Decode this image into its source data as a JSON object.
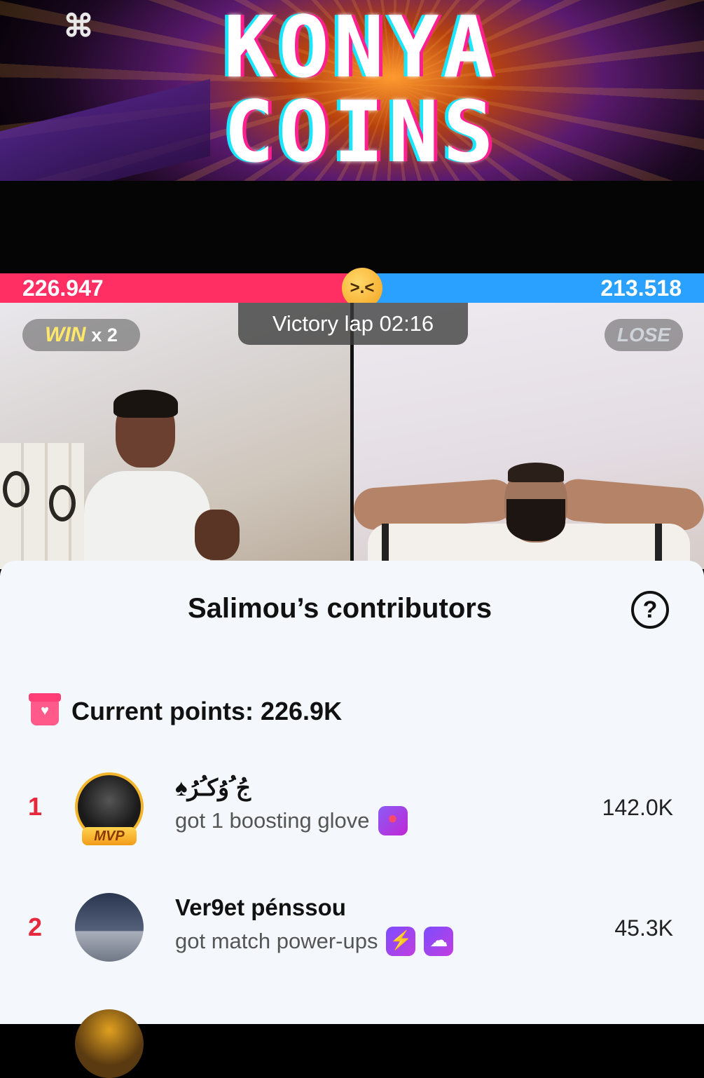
{
  "banner": {
    "title_line1": "KONYA",
    "title_line2": "COINS",
    "watermark_icon": "capcut-icon"
  },
  "battle": {
    "left_score": "226.947",
    "right_score": "213.518",
    "center_emoji": ">.<",
    "win_label": "WIN",
    "win_multiplier": "x 2",
    "lose_label": "LOSE",
    "timer_text": "Victory lap  02:16",
    "left_color": "#ff2e63",
    "right_color": "#2aa0ff",
    "left_share": 0.515
  },
  "sheet": {
    "title": "Salimou’s contributors",
    "help_icon": "?",
    "points_label": "Current points: 226.9K",
    "contributors": [
      {
        "rank": "1",
        "name": "♠جُ ُوُكـُرُ",
        "badge": "MVP",
        "description": "got 1 boosting glove",
        "score": "142.0K"
      },
      {
        "rank": "2",
        "name": "Ver9et pénssou",
        "badge": "",
        "description": "got match power-ups",
        "score": "45.3K"
      }
    ]
  }
}
